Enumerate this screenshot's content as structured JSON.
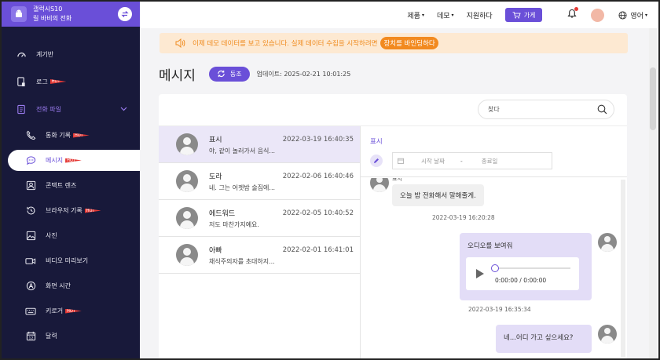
{
  "device": {
    "model": "갤럭시S10",
    "name": "릴 바비의 전화"
  },
  "sidebar": {
    "items": [
      {
        "label": "계기반"
      },
      {
        "label": "로그",
        "hot": "HOT"
      },
      {
        "label": "전화 파일"
      },
      {
        "label": "통화 기록",
        "hot": "HOT"
      },
      {
        "label": "메시지",
        "hot": "HOT"
      },
      {
        "label": "콘택트 렌즈"
      },
      {
        "label": "브라우저 기록",
        "hot": "HOT"
      },
      {
        "label": "사진"
      },
      {
        "label": "비디오 미리보기"
      },
      {
        "label": "화면 시간"
      },
      {
        "label": "키로거",
        "hot": "HOT"
      },
      {
        "label": "달력"
      }
    ]
  },
  "topbar": {
    "products": "제품",
    "demo": "데모",
    "support": "지원하다",
    "store": "가게",
    "language": "영어"
  },
  "banner": {
    "text": "이제 데모 데이터를 보고 있습니다. 실제 데이터 수집을 시작하려면",
    "action": "장치를 바인딩하다"
  },
  "page": {
    "title": "메시지",
    "sync_label": "동조",
    "update": "업데이트: 2025-02-21 10:01:25"
  },
  "search": {
    "placeholder": "찾다"
  },
  "conversations": [
    {
      "name": "표시",
      "snippet": "야, 같이 놀러가서 음식...",
      "time": "2022-03-19 16:40:35"
    },
    {
      "name": "도라",
      "snippet": "네. 그는 어젯밤 술집에...",
      "time": "2022-02-06 16:40:46"
    },
    {
      "name": "에드워드",
      "snippet": "저도 마찬가지예요.",
      "time": "2022-02-05 10:40:52"
    },
    {
      "name": "아빠",
      "snippet": "채식주의자를 초대하지...",
      "time": "2022-02-01 16:41:01"
    }
  ],
  "detail": {
    "name": "표시",
    "date_start_placeholder": "시작 날짜",
    "date_sep": "-",
    "date_end_placeholder": "종료일",
    "messages": [
      {
        "sender": "표시",
        "text": "오늘 밤 전화해서 말해줄게.",
        "time": "2022-03-19 16:20:28"
      },
      {
        "text": "오디오를 보여줘",
        "audio_time": "0:00:00 / 0:00:00",
        "time": "2022-03-19 16:35:34"
      },
      {
        "text": "네...어디 가고 싶으세요?"
      }
    ]
  },
  "colors": {
    "accent": "#6a4fd8",
    "sidebar_bg": "#18193a",
    "banner_bg": "#fde9d2",
    "banner_text": "#f08c20",
    "hot": "#e53935"
  }
}
